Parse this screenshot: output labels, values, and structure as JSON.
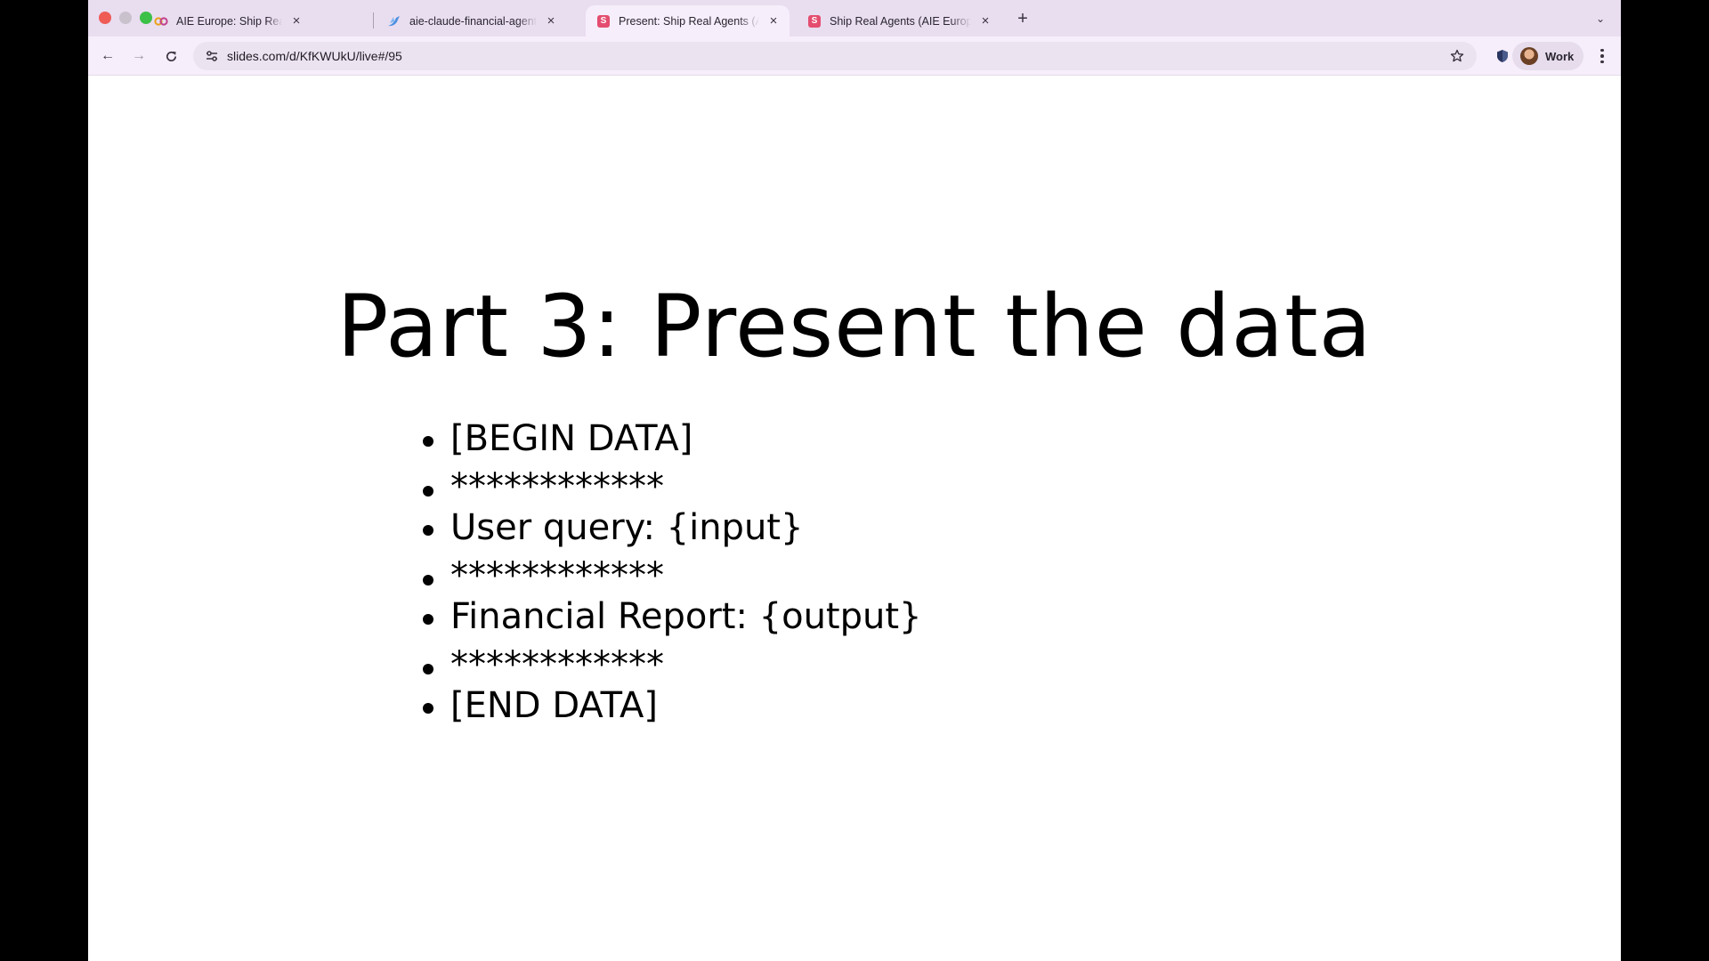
{
  "browser": {
    "tabs": [
      {
        "title": "AIE Europe: Ship Real Agents",
        "favicon": "link-logo-icon",
        "active": false
      },
      {
        "title": "aie-claude-financial-agent - I",
        "favicon": "bird-icon",
        "active": false
      },
      {
        "title": "Present: Ship Real Agents (AI",
        "favicon": "slides-icon",
        "active": true
      },
      {
        "title": "Ship Real Agents (AIE Europe",
        "favicon": "slides-icon",
        "active": false
      }
    ],
    "favicon_letter": "S",
    "tab_close_glyph": "×",
    "new_tab_glyph": "+",
    "tab_menu_glyph": "⌄",
    "url": "slides.com/d/KfKWUkU/live#/95",
    "profile_label": "Work",
    "nav_glyphs": {
      "back": "←",
      "forward": "→"
    }
  },
  "slide": {
    "title": "Part 3: Present the data",
    "bullets": [
      {
        "text": "[BEGIN DATA]",
        "kind": "text"
      },
      {
        "text": "************",
        "kind": "stars"
      },
      {
        "text": "User query: {input}",
        "kind": "text"
      },
      {
        "text": "************",
        "kind": "stars"
      },
      {
        "text": "Financial Report: {output}",
        "kind": "text"
      },
      {
        "text": "************",
        "kind": "stars"
      },
      {
        "text": "[END DATA]",
        "kind": "text"
      }
    ]
  },
  "colors": {
    "tabstrip": "#e9ddf0",
    "toolbar": "#f6eefa",
    "slides_accent": "#e44d6f"
  }
}
